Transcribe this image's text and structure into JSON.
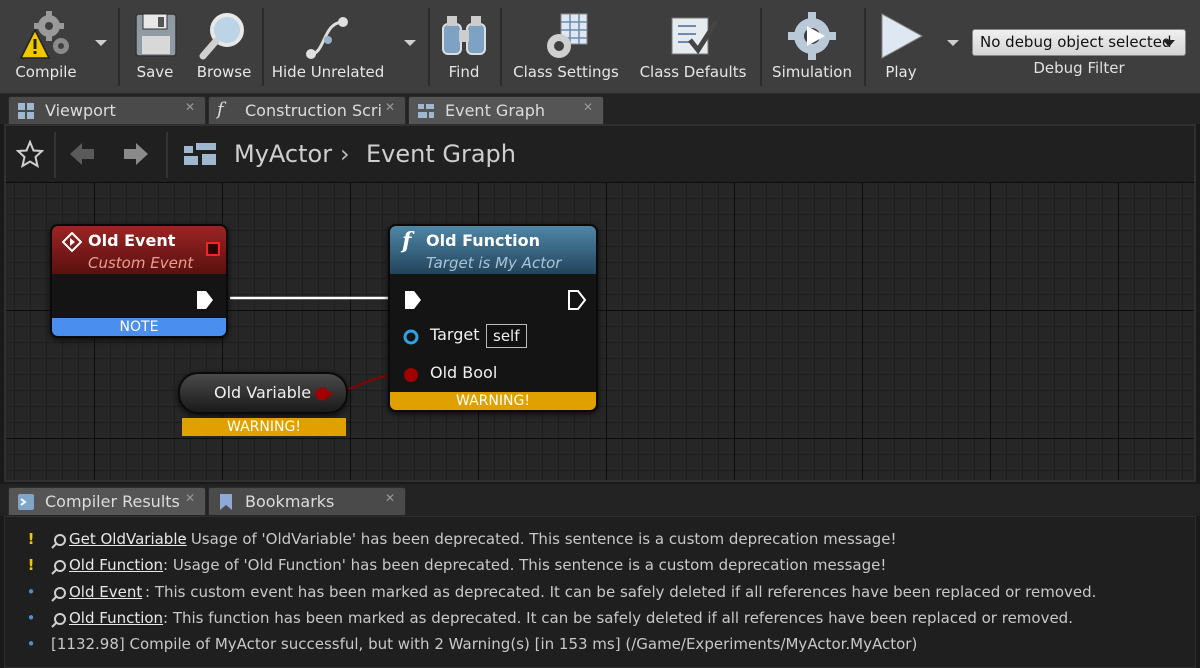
{
  "toolbar": {
    "compile": "Compile",
    "save": "Save",
    "browse": "Browse",
    "hide_unrelated": "Hide Unrelated",
    "find": "Find",
    "class_settings": "Class Settings",
    "class_defaults": "Class Defaults",
    "simulation": "Simulation",
    "play": "Play",
    "debug_object": "No debug object selected",
    "debug_filter": "Debug Filter"
  },
  "tabs": [
    {
      "label": "Viewport",
      "icon": "viewport-icon"
    },
    {
      "label": "Construction Script",
      "icon": "function-icon"
    },
    {
      "label": "Event Graph",
      "icon": "graph-icon"
    }
  ],
  "breadcrumb": {
    "actor": "MyActor",
    "separator": "›",
    "graph": "Event Graph"
  },
  "nodes": {
    "old_event": {
      "title": "Old Event",
      "subtitle": "Custom Event",
      "badge": "NOTE"
    },
    "old_function": {
      "title": "Old Function",
      "subtitle": "Target is My Actor",
      "target_label": "Target",
      "target_value": "self",
      "bool_label": "Old Bool",
      "badge": "WARNING!"
    },
    "old_variable": {
      "title": "Old Variable",
      "badge": "WARNING!"
    }
  },
  "bottom_tabs": [
    {
      "label": "Compiler Results",
      "icon": "compiler-results-icon"
    },
    {
      "label": "Bookmarks",
      "icon": "bookmark-icon"
    }
  ],
  "messages": [
    {
      "level": "warning",
      "bullet": "!",
      "link": "Get OldVariable",
      "text": ": Usage of 'OldVariable' has been deprecated. This sentence is a custom deprecation message!"
    },
    {
      "level": "warning",
      "bullet": "!",
      "link": "Old Function",
      "text": ": Usage of 'Old Function' has been deprecated. This sentence is a custom deprecation message!"
    },
    {
      "level": "info",
      "bullet": "•",
      "link": "Old Event",
      "text": ": This custom event has been marked as deprecated. It can be safely deleted if all references have been replaced or removed."
    },
    {
      "level": "info",
      "bullet": "•",
      "link": "Old Function",
      "text": ": This function has been marked as deprecated. It can be safely deleted if all references have been replaced or removed."
    },
    {
      "level": "info",
      "bullet": "•",
      "link": "",
      "text": "[1132.98] Compile of MyActor successful, but with 2 Warning(s) [in 153 ms] (/Game/Experiments/MyActor.MyActor)"
    }
  ],
  "colors": {
    "event_header": "#8a1c1c",
    "function_header": "#3d6f8c",
    "note_badge": "#4a8ff0",
    "warning_badge": "#e0a000",
    "exec_wire": "#ffffff",
    "bool_wire": "#8c0000"
  }
}
